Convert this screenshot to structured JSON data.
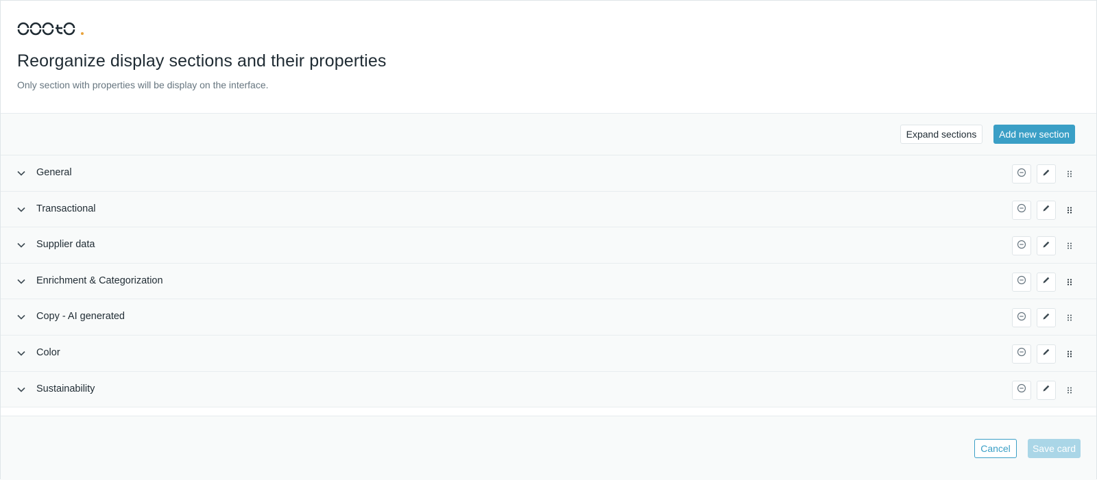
{
  "header": {
    "logo_text": "occtoo.",
    "title": "Reorganize display sections and their properties",
    "subtitle": "Only section with properties will be display on the interface."
  },
  "toolbar": {
    "expand_label": "Expand sections",
    "add_label": "Add new section"
  },
  "sections": [
    {
      "label": "General"
    },
    {
      "label": "Transactional"
    },
    {
      "label": "Supplier data"
    },
    {
      "label": "Enrichment & Categorization"
    },
    {
      "label": "Copy - AI generated"
    },
    {
      "label": "Color"
    },
    {
      "label": "Sustainability"
    }
  ],
  "footer": {
    "cancel_label": "Cancel",
    "save_label": "Save card"
  },
  "icons": {
    "chevron": "chevron-down-icon",
    "remove": "minus-circle-icon",
    "edit": "pencil-icon",
    "drag": "drag-handle-icon"
  },
  "colors": {
    "accent": "#3a9fc6",
    "accent_disabled": "#aad6e7",
    "logo_dot": "#e8a33c",
    "text_primary": "#1f2b33",
    "text_secondary": "#66757f",
    "row_bg": "#f8fafa"
  }
}
